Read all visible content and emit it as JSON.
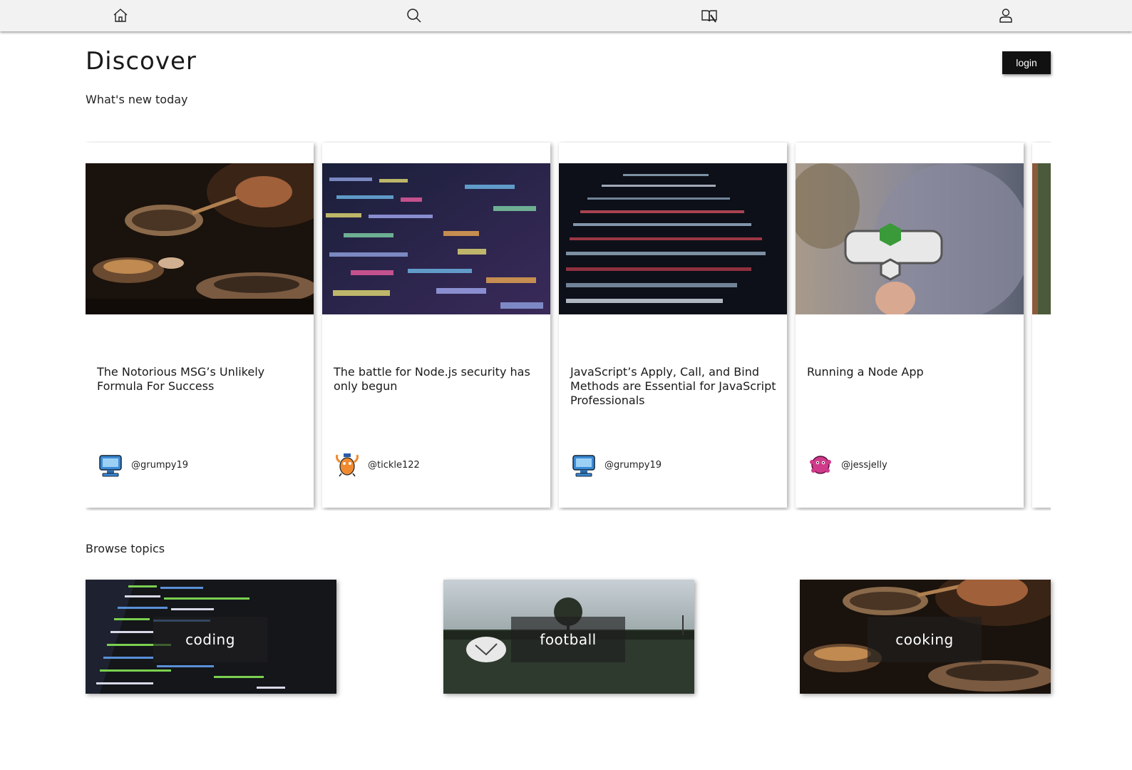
{
  "nav": {
    "items": [
      {
        "icon": "home-icon"
      },
      {
        "icon": "search-icon"
      },
      {
        "icon": "book-icon"
      },
      {
        "icon": "user-icon"
      }
    ]
  },
  "header": {
    "title": "Discover",
    "login_label": "login",
    "subtitle": "What's new today"
  },
  "articles": [
    {
      "title": "The Notorious MSG’s Unlikely Formula For Success",
      "author": "@grumpy19",
      "image": "cooking-photo",
      "avatar": "blue-robot-avatar"
    },
    {
      "title": "The battle for Node.js security has only begun",
      "author": "@tickle122",
      "image": "code-screen-photo",
      "avatar": "orange-creature-avatar"
    },
    {
      "title": "JavaScript’s Apply, Call, and Bind Methods are Essential for JavaScript Professionals",
      "author": "@grumpy19",
      "image": "dark-code-photo",
      "avatar": "blue-robot-avatar"
    },
    {
      "title": "Running a Node App",
      "author": "@jessjelly",
      "image": "nodejs-sticker-photo",
      "avatar": "pink-creature-avatar"
    }
  ],
  "topics": {
    "label": "Browse topics",
    "items": [
      {
        "name": "coding"
      },
      {
        "name": "football"
      },
      {
        "name": "cooking"
      }
    ]
  }
}
